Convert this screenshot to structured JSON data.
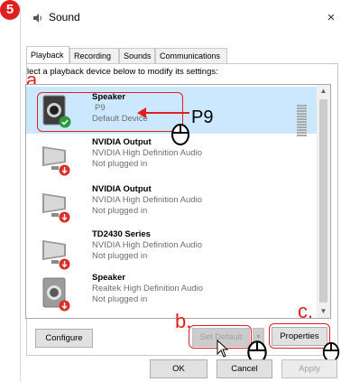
{
  "step_badge": "5",
  "window": {
    "title": "Sound",
    "close_glyph": "×",
    "icon": "speaker-icon"
  },
  "tabs": [
    {
      "label": "Playback",
      "active": true
    },
    {
      "label": "Recording",
      "active": false
    },
    {
      "label": "Sounds",
      "active": false
    },
    {
      "label": "Communications",
      "active": false
    }
  ],
  "instruction": "lect a playback device below to modify its settings:",
  "devices": [
    {
      "name": "Speaker",
      "line1": "P9",
      "line2": "Default Device",
      "icon": "speaker-icon",
      "status": "default-check",
      "selected": true
    },
    {
      "name": "NVIDIA Output",
      "line1": "NVIDIA High Definition Audio",
      "line2": "Not plugged in",
      "icon": "monitor-icon",
      "status": "unplugged-arrow",
      "selected": false
    },
    {
      "name": "NVIDIA Output",
      "line1": "NVIDIA High Definition Audio",
      "line2": "Not plugged in",
      "icon": "monitor-icon",
      "status": "unplugged-arrow",
      "selected": false
    },
    {
      "name": "TD2430 Series",
      "line1": "NVIDIA High Definition Audio",
      "line2": "Not plugged in",
      "icon": "monitor-icon",
      "status": "unplugged-arrow",
      "selected": false
    },
    {
      "name": "Speaker",
      "line1": "Realtek High Definition Audio",
      "line2": "Not plugged in",
      "icon": "speaker-icon",
      "status": "unplugged-arrow",
      "selected": false
    }
  ],
  "buttons": {
    "configure": "Configure",
    "set_default": "Set Default",
    "properties": "Properties",
    "ok": "OK",
    "cancel": "Cancel",
    "apply": "Apply"
  },
  "annotations": {
    "a": "a.",
    "b": "b.",
    "c": "c.",
    "p9_callout": "P9"
  },
  "colors": {
    "annotation_red": "#e02020",
    "selected_row": "#cce8ff",
    "default_check": "#2d9b3a",
    "unplugged_red": "#d93025"
  }
}
